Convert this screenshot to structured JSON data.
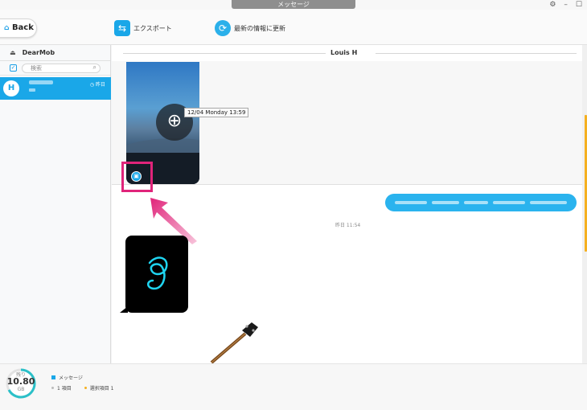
{
  "window": {
    "title": "メッセージ"
  },
  "toolbar": {
    "back_label": "Back",
    "export_label": "エクスポート",
    "refresh_label": "最新の情報に更新"
  },
  "sidebar": {
    "device_name": "DearMob",
    "search_placeholder": "検索",
    "contacts": [
      {
        "avatar_letter": "H",
        "time": "昨日"
      }
    ]
  },
  "chat": {
    "contact_name": "Louis H",
    "image_tooltip": "12/04 Monday 13:59",
    "timestamp": "昨日 11:54",
    "colors": {
      "outgoing_bubble": "#2ab3ee",
      "highlight": "#e0247a",
      "accent": "#1aa7e8"
    }
  },
  "status": {
    "free_label": "残り",
    "free_value": "10.80",
    "free_unit": "GB",
    "category_label": "メッセージ",
    "item_count": "1 項目",
    "selected": "選択項目 1"
  }
}
